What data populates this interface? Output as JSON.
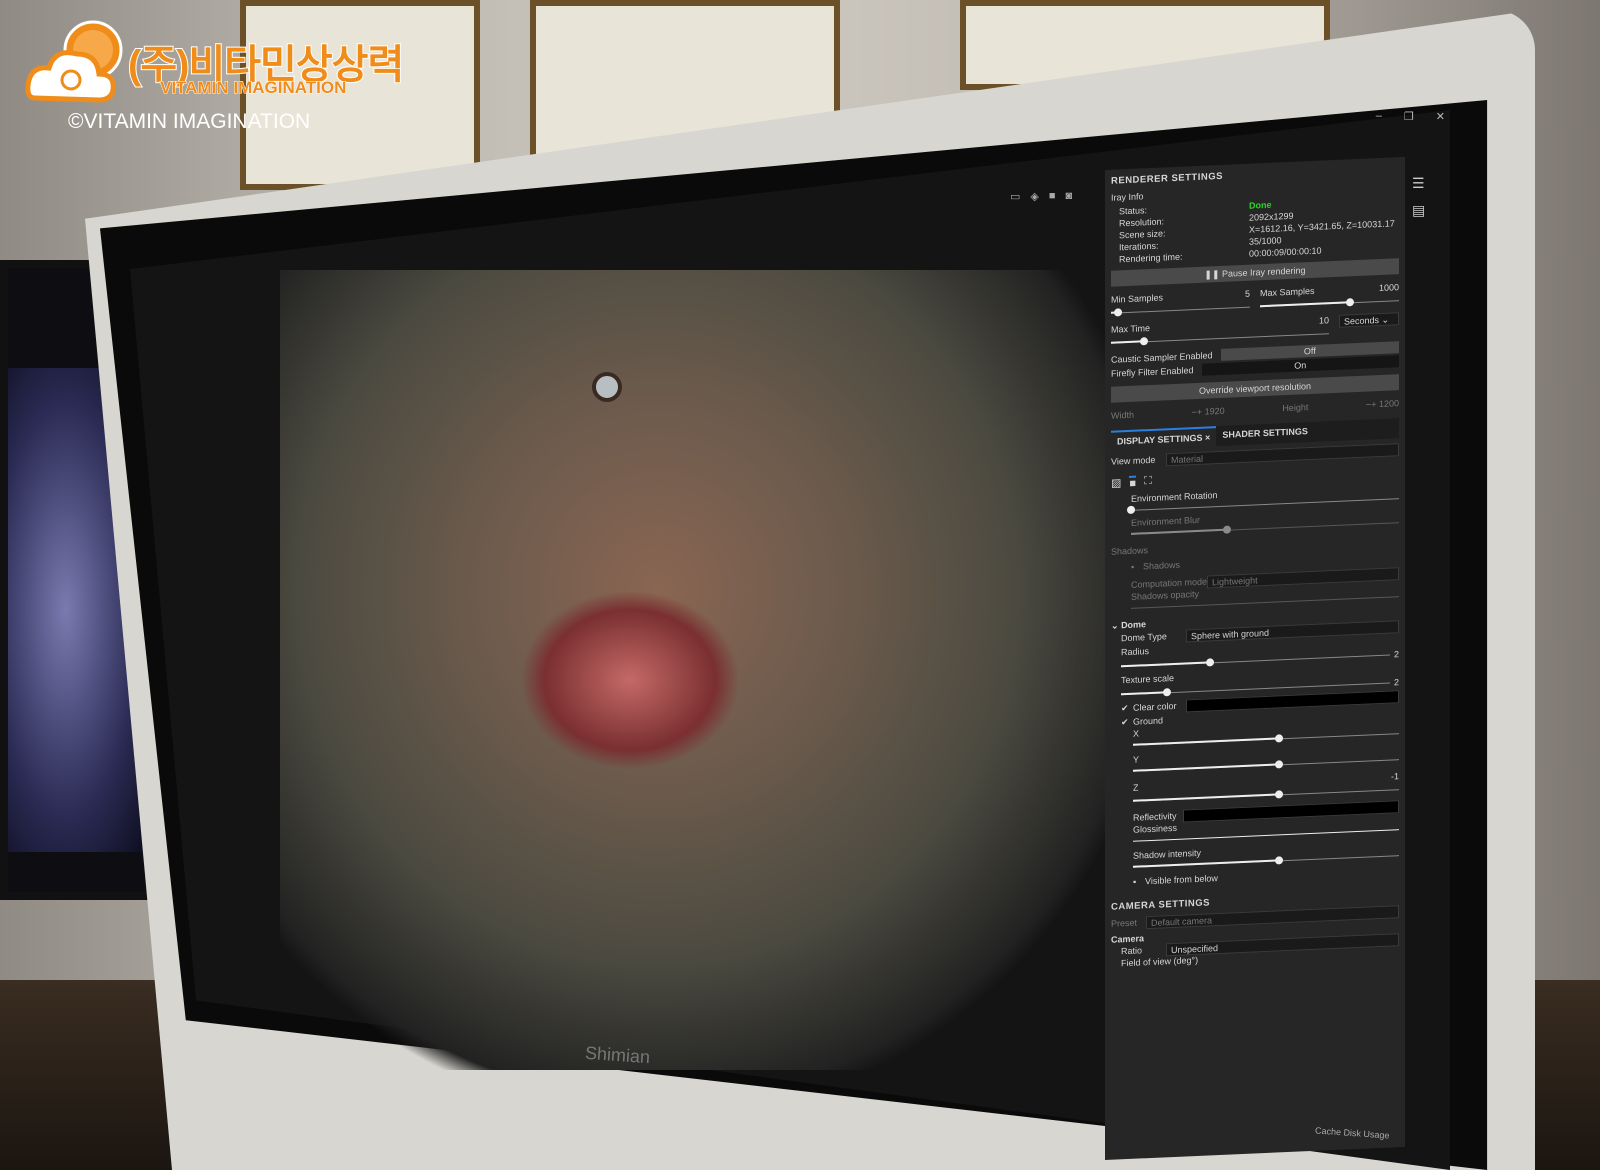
{
  "watermark": {
    "korean": "(주)비타민상상력",
    "english": "VITAMIN IMAGINATION",
    "copyright": "©VITAMIN IMAGINATION"
  },
  "monitor_brand": "Shimian",
  "renderer": {
    "title": "RENDERER SETTINGS",
    "section": "Iray Info",
    "info": [
      {
        "label": "Status:",
        "value": "Done"
      },
      {
        "label": "Resolution:",
        "value": "2092x1299"
      },
      {
        "label": "Scene size:",
        "value": "X=1612.16, Y=3421.65, Z=10031.17"
      },
      {
        "label": "Iterations:",
        "value": "35/1000"
      },
      {
        "label": "Rendering time:",
        "value": "00:00:09/00:00:10"
      }
    ],
    "pause_button": "Pause Iray rendering",
    "min_samples": {
      "label": "Min Samples",
      "value": "5",
      "fraction": 0.05
    },
    "max_samples": {
      "label": "Max Samples",
      "value": "1000",
      "fraction": 0.65
    },
    "max_time": {
      "label": "Max Time",
      "value": "10",
      "unit": "Seconds",
      "fraction": 0.15
    },
    "caustic": {
      "label": "Caustic Sampler Enabled",
      "value": "Off"
    },
    "firefly": {
      "label": "Firefly Filter Enabled",
      "value": "On"
    },
    "override_button": "Override viewport resolution",
    "width": {
      "label": "Width",
      "value": "1920"
    },
    "height": {
      "label": "Height",
      "value": "1200"
    }
  },
  "display": {
    "tabs": [
      {
        "label": "DISPLAY SETTINGS"
      },
      {
        "label": "SHADER SETTINGS"
      }
    ],
    "close_icon": "×",
    "view_mode": {
      "label": "View mode",
      "value": "Material"
    },
    "env_rotation": {
      "label": "Environment Rotation",
      "fraction": 0.0
    },
    "env_blur": {
      "label": "Environment Blur",
      "fraction": 0.36
    },
    "shadows_section": "Shadows",
    "shadows_check": "Shadows",
    "computation_mode": {
      "label": "Computation mode",
      "value": "Lightweight"
    },
    "shadows_opacity": "Shadows opacity",
    "dome": "Dome",
    "dome_type": {
      "label": "Dome Type",
      "value": "Sphere with ground"
    },
    "radius": {
      "label": "Radius",
      "value": "2",
      "fraction": 0.33
    },
    "texture_scale": {
      "label": "Texture scale",
      "value": "2",
      "fraction": 0.17
    },
    "clear_color": "Clear color",
    "ground": "Ground",
    "x": {
      "label": "X",
      "fraction": 0.55
    },
    "y": {
      "label": "Y",
      "fraction": 0.55
    },
    "z": {
      "label": "Z",
      "value": "-1",
      "fraction": 0.55
    },
    "reflectivity": "Reflectivity",
    "glossiness": "Glossiness",
    "shadow_intensity": {
      "label": "Shadow intensity",
      "fraction": 0.55
    },
    "visible_below": "Visible from below"
  },
  "camera": {
    "title": "CAMERA SETTINGS",
    "preset": {
      "label": "Preset",
      "value": "Default camera"
    },
    "section": "Camera",
    "ratio": {
      "label": "Ratio",
      "value": "Unspecified"
    },
    "fov": "Field of view (deg°)",
    "cache": "Cache Disk Usage"
  }
}
